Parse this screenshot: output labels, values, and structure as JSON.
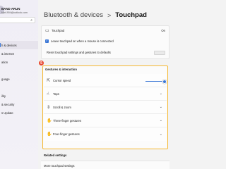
{
  "window": {
    "minimize": "—",
    "maximize": "☐",
    "close": "✕"
  },
  "account": {
    "name": "BAND ARUN",
    "email": "kjbr1904@outlook.com"
  },
  "sidebar": {
    "items": [
      {
        "label": "h & devices"
      },
      {
        "label": "& internet"
      },
      {
        "label": "ation"
      },
      {
        "label": ""
      },
      {
        "label": "guage"
      },
      {
        "label": ""
      },
      {
        "label": "ility"
      },
      {
        "label": "& security"
      },
      {
        "label": "s Update"
      }
    ]
  },
  "header": {
    "breadcrumb_parent": "Bluetooth & devices",
    "separator": ">",
    "title": "Touchpad"
  },
  "touchpad_row": {
    "label": "Touchpad",
    "state": "On"
  },
  "leave_on": {
    "label": "Leave touchpad on when a mouse is connected"
  },
  "reset_row": {
    "label": "Reset touchpad settings and gestures to defaults"
  },
  "step_badge": "5",
  "gestures": {
    "title": "Gestures & interaction",
    "items": [
      {
        "label": "Cursor speed",
        "icon": "cursor-speed-icon"
      },
      {
        "label": "Taps",
        "icon": "tap-icon"
      },
      {
        "label": "Scroll & zoom",
        "icon": "scroll-icon"
      },
      {
        "label": "Three-finger gestures",
        "icon": "hand-icon"
      },
      {
        "label": "Four-finger gestures",
        "icon": "hand-icon"
      }
    ],
    "cursor_speed_level": 0.9
  },
  "related": {
    "title": "Related settings",
    "more_label": "More touchpad settings"
  },
  "colors": {
    "accent": "#3b77d6",
    "highlight": "#f5b730",
    "badge": "#e8462e"
  }
}
